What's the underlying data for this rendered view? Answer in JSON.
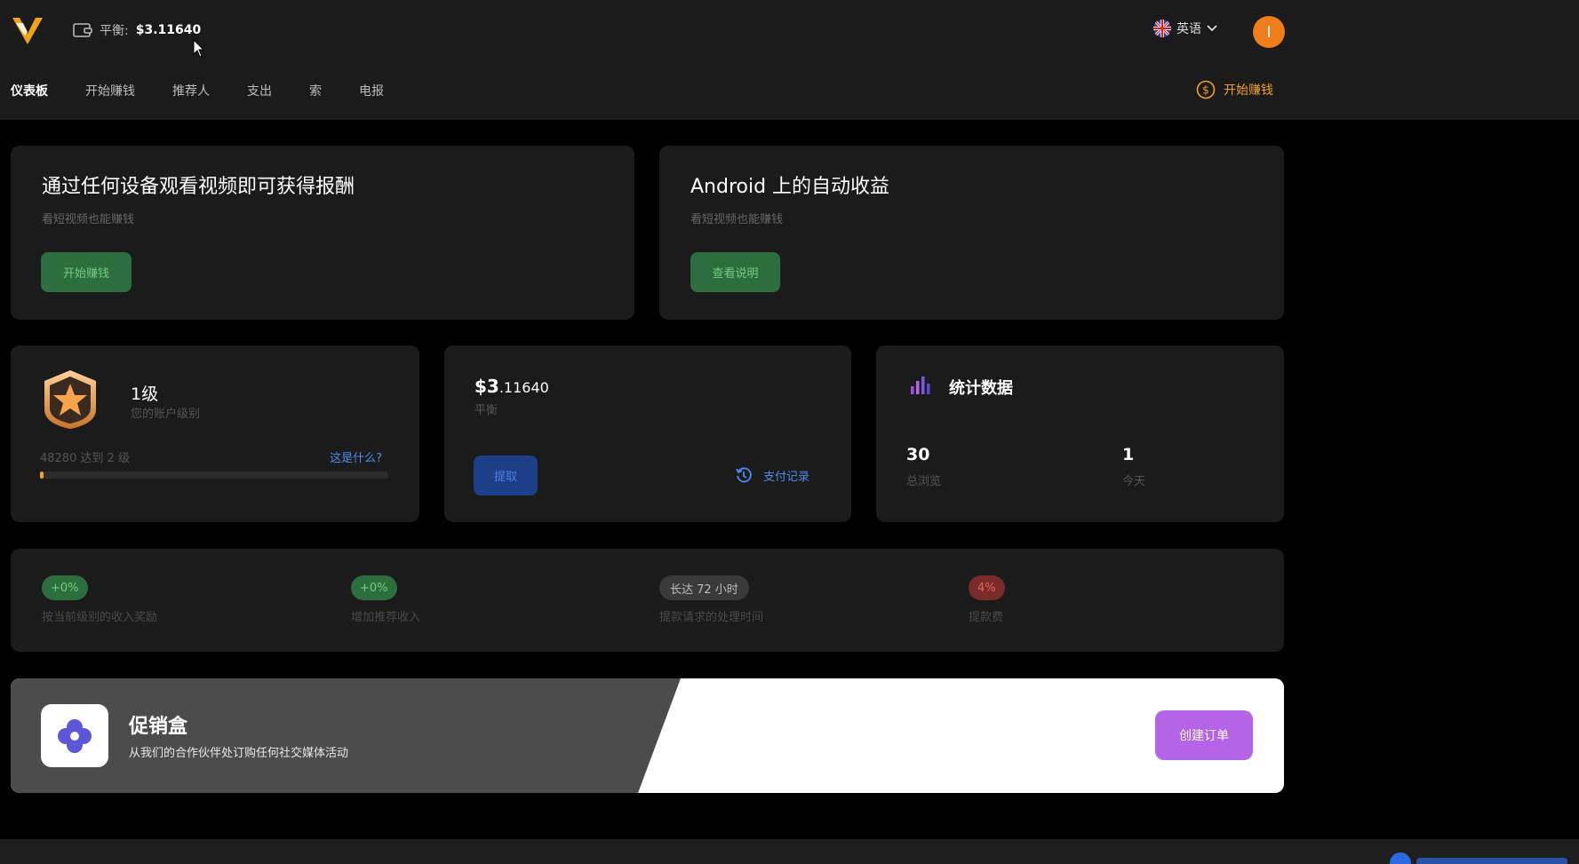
{
  "header": {
    "balance_label": "平衡:",
    "balance_value": "$3.11640",
    "language": "英语",
    "avatar_initial": "I"
  },
  "nav": {
    "items": [
      "仪表板",
      "开始赚钱",
      "推荐人",
      "支出",
      "索",
      "电报"
    ],
    "earn_link": "开始赚钱"
  },
  "cards": {
    "watch": {
      "title": "通过任何设备观看视频即可获得报酬",
      "subtitle": "看短视频也能赚钱",
      "button": "开始赚钱"
    },
    "android": {
      "title": "Android 上的自动收益",
      "subtitle": "看短视频也能赚钱",
      "button": "查看说明"
    }
  },
  "level": {
    "title": "1级",
    "subtitle": "您的账户级别",
    "progress_text": "48280 达到 2 级",
    "link": "这是什么?",
    "progress_fraction": 0.01
  },
  "balance_card": {
    "amount_main": "$3",
    "amount_cents": ".11640",
    "subtitle": "平衡",
    "withdraw_button": "提取",
    "history_link": "支付记录"
  },
  "stats": {
    "title": "统计数据",
    "total_value": "30",
    "total_label": "总浏览",
    "today_value": "1",
    "today_label": "今天"
  },
  "info": {
    "items": [
      {
        "badge": "+0%",
        "label": "按当前级别的收入奖励"
      },
      {
        "badge": "+0%",
        "label": "增加推荐收入"
      },
      {
        "badge": "长达 72 小时",
        "label": "提款请求的处理时间"
      },
      {
        "badge": "4%",
        "label": "提款费"
      }
    ]
  },
  "promo": {
    "title": "促销盒",
    "subtitle": "从我们的合作伙伴处订购任何社交媒体活动",
    "button": "创建订单"
  },
  "colors": {
    "accent_orange": "#f0a31a",
    "green": "#2d6e3f",
    "blue_link": "#4a8cf0",
    "purple": "#b564e8"
  }
}
